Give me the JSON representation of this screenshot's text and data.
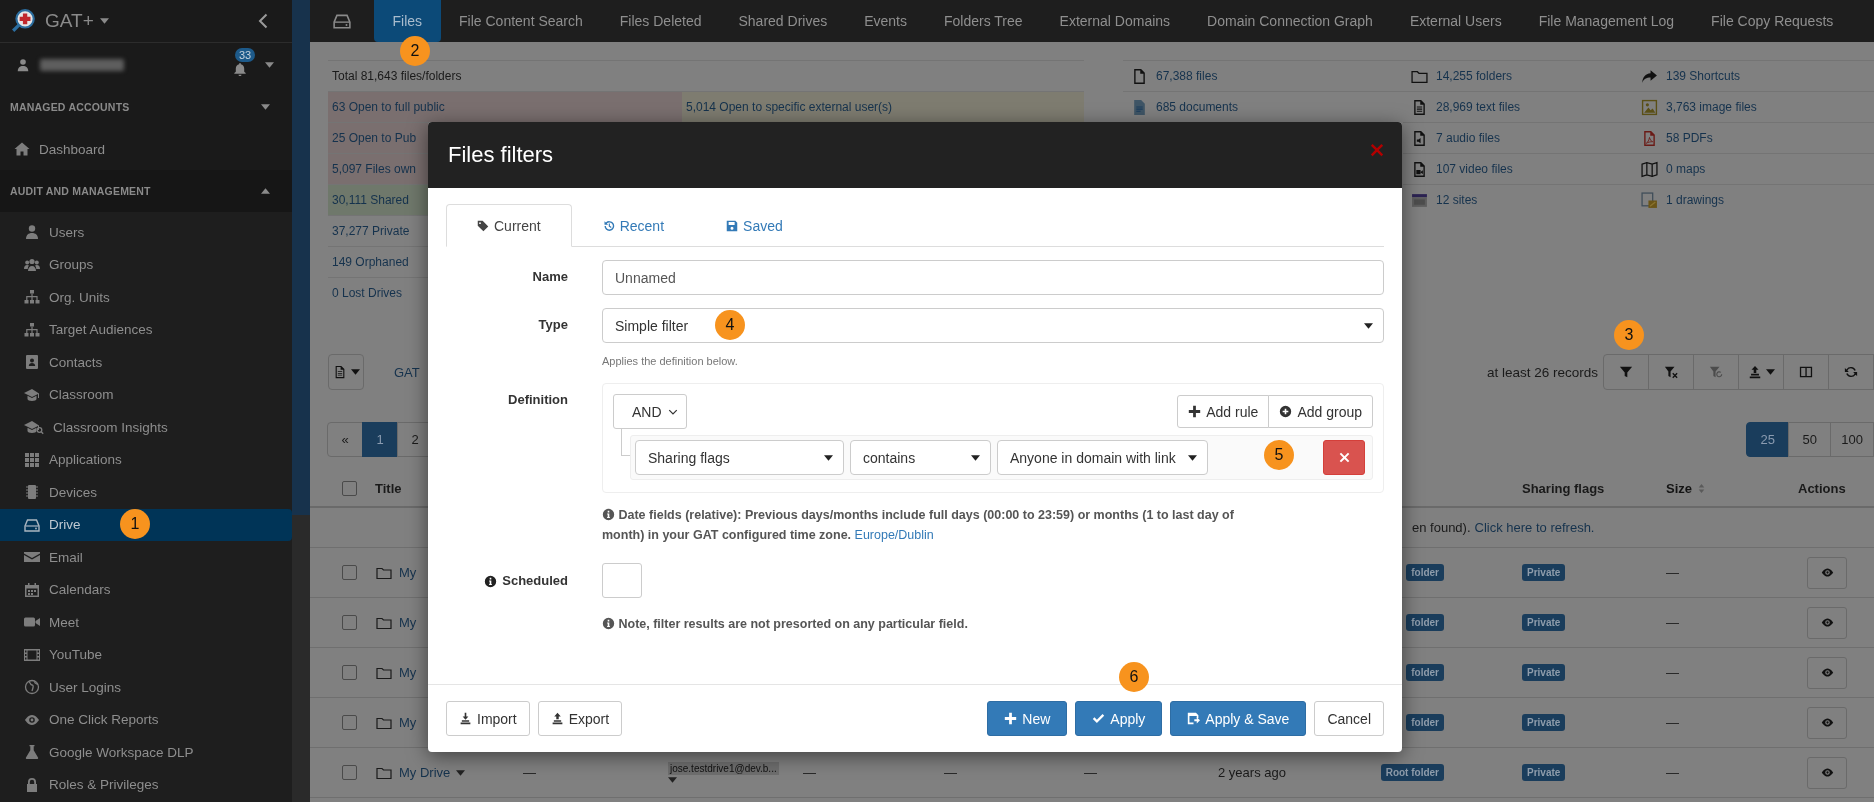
{
  "sidebar": {
    "brand": "GAT+",
    "notifications": "33",
    "sections": [
      {
        "title": "MANAGED ACCOUNTS",
        "expanded": false,
        "items": [
          {
            "label": "Dashboard",
            "selected": false
          }
        ]
      },
      {
        "title": "AUDIT AND MANAGEMENT",
        "expanded": true,
        "items": [
          {
            "label": "Users",
            "selected": false
          },
          {
            "label": "Groups",
            "selected": false
          },
          {
            "label": "Org. Units",
            "selected": false
          },
          {
            "label": "Target Audiences",
            "selected": false
          },
          {
            "label": "Contacts",
            "selected": false
          },
          {
            "label": "Classroom",
            "selected": false
          },
          {
            "label": "Classroom Insights",
            "selected": false
          },
          {
            "label": "Applications",
            "selected": false
          },
          {
            "label": "Devices",
            "selected": false
          },
          {
            "label": "Drive",
            "selected": true
          },
          {
            "label": "Email",
            "selected": false
          },
          {
            "label": "Calendars",
            "selected": false
          },
          {
            "label": "Meet",
            "selected": false
          },
          {
            "label": "YouTube",
            "selected": false
          },
          {
            "label": "User Logins",
            "selected": false
          },
          {
            "label": "One Click Reports",
            "selected": false
          },
          {
            "label": "Google Workspace DLP",
            "selected": false
          },
          {
            "label": "Roles & Privileges",
            "selected": false
          }
        ]
      }
    ]
  },
  "top_nav": {
    "tabs": [
      {
        "label": "Files",
        "selected": true
      },
      {
        "label": "File Content Search",
        "selected": false
      },
      {
        "label": "Files Deleted",
        "selected": false
      },
      {
        "label": "Shared Drives",
        "selected": false
      },
      {
        "label": "Events",
        "selected": false
      },
      {
        "label": "Folders Tree",
        "selected": false
      },
      {
        "label": "External Domains",
        "selected": false
      },
      {
        "label": "Domain Connection Graph",
        "selected": false
      },
      {
        "label": "External Users",
        "selected": false
      },
      {
        "label": "File Management Log",
        "selected": false
      },
      {
        "label": "File Copy Requests",
        "selected": false
      }
    ]
  },
  "summary": {
    "total": "Total 81,643 files/folders",
    "rows": [
      {
        "cells": [
          {
            "text": "63 Open to full public",
            "kind": "danger"
          },
          {
            "text": "5,014 Open to specific external user(s)",
            "kind": "warning"
          }
        ]
      },
      {
        "cells": [
          {
            "text": "25 Open to Pub",
            "kind": "danger"
          }
        ]
      },
      {
        "cells": [
          {
            "text": "5,097 Files own",
            "kind": "danger"
          }
        ]
      },
      {
        "cells": [
          {
            "text": "30,111 Shared",
            "kind": "success"
          }
        ]
      },
      {
        "cells": [
          {
            "text": "37,277 Private",
            "kind": "plain"
          }
        ]
      },
      {
        "cells": [
          {
            "text": "149 Orphaned",
            "kind": "plain"
          }
        ]
      },
      {
        "cells": [
          {
            "text": "0 Lost Drives",
            "kind": "plain"
          }
        ]
      }
    ],
    "file_types": {
      "columns": [
        [
          "67,388 files",
          "685 documents"
        ],
        [
          "14,255 folders",
          "28,969 text files",
          "7 audio files",
          "107 video files",
          "12 sites"
        ],
        [
          "139 Shortcuts",
          "3,763 image files",
          "58 PDFs",
          "0 maps",
          "1 drawings"
        ]
      ]
    }
  },
  "toolbar": {
    "view_link": "GAT",
    "records": "at least 26 records"
  },
  "pagination": {
    "pages": [
      {
        "label": "«",
        "selected": false
      },
      {
        "label": "1",
        "selected": true
      },
      {
        "label": "2",
        "selected": false
      }
    ],
    "page_sizes": [
      {
        "label": "25",
        "selected": true
      },
      {
        "label": "50",
        "selected": false
      },
      {
        "label": "100",
        "selected": false
      }
    ]
  },
  "table": {
    "select_all": false,
    "columns": [
      {
        "label": "Title",
        "sortable": false
      },
      {
        "label": "Sharing flags",
        "sortable": false
      },
      {
        "label": "Size",
        "sortable": true
      },
      {
        "label": "Actions",
        "sortable": false
      }
    ],
    "notice": {
      "text": "en found).",
      "link": "Click here to refresh."
    },
    "rows": [
      {
        "checked": false,
        "title": "My",
        "menu": false,
        "type": "folder",
        "sharing": "Private",
        "size": "—"
      },
      {
        "checked": false,
        "title": "My",
        "menu": false,
        "type": "folder",
        "sharing": "Private",
        "size": "—"
      },
      {
        "checked": false,
        "title": "My",
        "menu": false,
        "type": "folder",
        "sharing": "Private",
        "size": "—"
      },
      {
        "checked": false,
        "title": "My",
        "menu": false,
        "type": "folder",
        "sharing": "Private",
        "size": "—"
      },
      {
        "checked": false,
        "title": "My Drive",
        "menu": true,
        "cells": [
          {
            "text": "—",
            "menu": false
          },
          {
            "text": "jose.testdrive1@dev.b...",
            "menu": true
          },
          {
            "text": "—",
            "menu": false
          },
          {
            "text": "—",
            "menu": false
          },
          {
            "text": "—",
            "menu": false
          },
          {
            "text": "2 years ago",
            "menu": false
          }
        ],
        "type": "Root folder",
        "sharing": "Private",
        "size": "—"
      }
    ]
  },
  "modal": {
    "title": "Files filters",
    "tabs": [
      {
        "label": "Current",
        "selected": true
      },
      {
        "label": "Recent",
        "selected": false
      },
      {
        "label": "Saved",
        "selected": false
      }
    ],
    "name": {
      "label": "Name",
      "value": "Unnamed"
    },
    "type": {
      "label": "Type",
      "value": "Simple filter",
      "help": "Applies the definition below."
    },
    "definition": {
      "label": "Definition",
      "operator": "AND",
      "add_rule": "Add rule",
      "add_group": "Add group",
      "rules": [
        {
          "field": "Sharing flags",
          "operator": "contains",
          "value": "Anyone in domain with link"
        }
      ]
    },
    "date_note": {
      "text": "Date fields (relative): Previous days/months include full days (00:00 to 23:59) or months (1 to last day of month) in your GAT configured time zone.",
      "link": "Europe/Dublin"
    },
    "scheduled": {
      "label": "Scheduled",
      "checked": false
    },
    "note": "Note, filter results are not presorted on any particular field.",
    "footer": {
      "left": [
        "Import",
        "Export"
      ],
      "right": [
        {
          "label": "New",
          "kind": "primary"
        },
        {
          "label": "Apply",
          "kind": "primary"
        },
        {
          "label": "Apply & Save",
          "kind": "primary"
        },
        {
          "label": "Cancel",
          "kind": "default"
        }
      ]
    }
  },
  "annotations": [
    {
      "label": "1"
    },
    {
      "label": "2"
    },
    {
      "label": "3"
    },
    {
      "label": "4"
    },
    {
      "label": "5"
    },
    {
      "label": "6"
    }
  ]
}
